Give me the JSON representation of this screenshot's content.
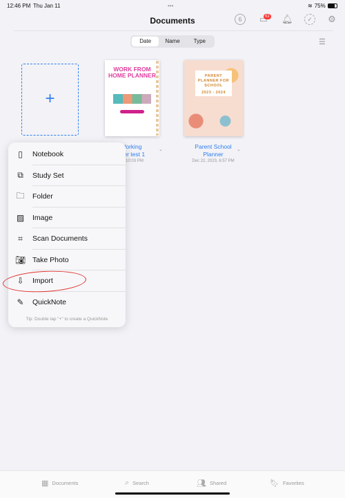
{
  "status": {
    "time": "12:46 PM",
    "date": "Thu Jan 11",
    "dots": "•••",
    "battery": "75%"
  },
  "header": {
    "title": "Documents",
    "badge": "62",
    "icons": [
      "timer-icon",
      "inbox-icon",
      "bell-icon",
      "check-circle-icon",
      "gear-icon"
    ]
  },
  "sort": {
    "options": [
      "Date",
      "Name",
      "Type"
    ],
    "selected": "Date"
  },
  "add_label": "+",
  "documents": [
    {
      "cover_title": "WORK FROM HOME PLANNER",
      "title_line1": "Working",
      "title_line2": "nner test 1",
      "date": "24, 10:03 PM"
    },
    {
      "cover_title": "PARENT PLANNER FOR SCHOOL",
      "cover_years": "2023 - 2024",
      "title_line1": "Parent School",
      "title_line2": "Planner",
      "date": "Dec 22, 2023, 6:57 PM"
    }
  ],
  "menu": {
    "items": [
      {
        "label": "Notebook",
        "icon": "notebook-icon"
      },
      {
        "label": "Study Set",
        "icon": "study-set-icon"
      },
      {
        "label": "Folder",
        "icon": "folder-icon"
      },
      {
        "label": "Image",
        "icon": "image-icon"
      },
      {
        "label": "Scan Documents",
        "icon": "scan-icon"
      },
      {
        "label": "Take Photo",
        "icon": "camera-icon"
      },
      {
        "label": "Import",
        "icon": "import-icon"
      },
      {
        "label": "QuickNote",
        "icon": "quicknote-icon"
      }
    ],
    "tip": "Tip: Double tap \"+\" to create a QuickNote"
  },
  "annotation_color": "#e0302a",
  "tabs": [
    {
      "label": "Documents"
    },
    {
      "label": "Search"
    },
    {
      "label": "Shared"
    },
    {
      "label": "Favorites"
    }
  ]
}
